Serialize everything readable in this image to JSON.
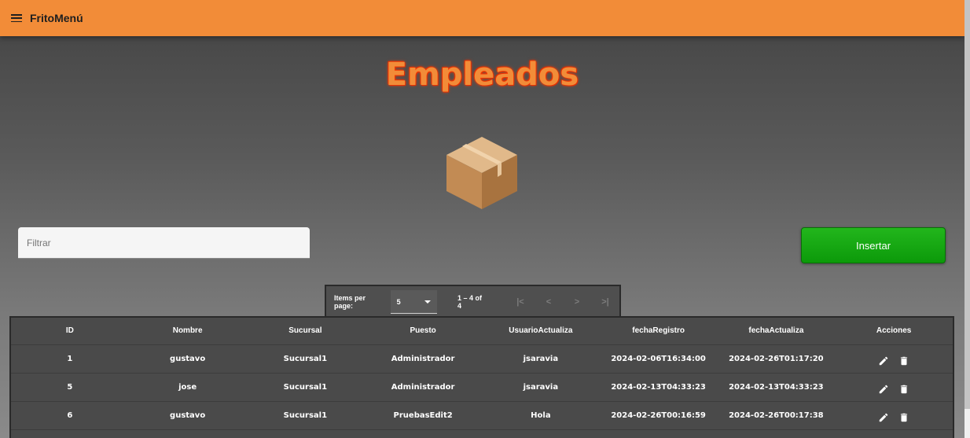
{
  "app": {
    "title": "FritoMenú"
  },
  "page": {
    "title": "Empleados"
  },
  "filter": {
    "placeholder": "Filtrar"
  },
  "insert_button": {
    "label": "Insertar"
  },
  "paginator": {
    "items_per_page_label": "Items per page:",
    "page_size": "5",
    "range": "1 – 4 of 4",
    "nav": [
      "|<",
      "<",
      ">",
      ">|"
    ]
  },
  "table": {
    "headers": [
      "ID",
      "Nombre",
      "Sucursal",
      "Puesto",
      "UsuarioActualiza",
      "fechaRegistro",
      "fechaActualiza",
      "Acciones"
    ],
    "rows": [
      [
        "1",
        "gustavo",
        "Sucursal1",
        "Administrador",
        "jsaravia",
        "2024-02-06T16:34:00",
        "2024-02-26T01:17:20"
      ],
      [
        "5",
        "jose",
        "Sucursal1",
        "Administrador",
        "jsaravia",
        "2024-02-13T04:33:23",
        "2024-02-13T04:33:23"
      ],
      [
        "6",
        "gustavo",
        "Sucursal1",
        "PruebasEdit2",
        "Hola",
        "2024-02-26T00:16:59",
        "2024-02-26T00:17:38"
      ]
    ]
  },
  "icons": {
    "menu": "menu-icon",
    "box": "box-icon",
    "edit": "edit-icon",
    "delete": "delete-icon"
  },
  "colors": {
    "toolbar": "#f28c38",
    "insert": "#17a813",
    "title": "#f28c38"
  }
}
